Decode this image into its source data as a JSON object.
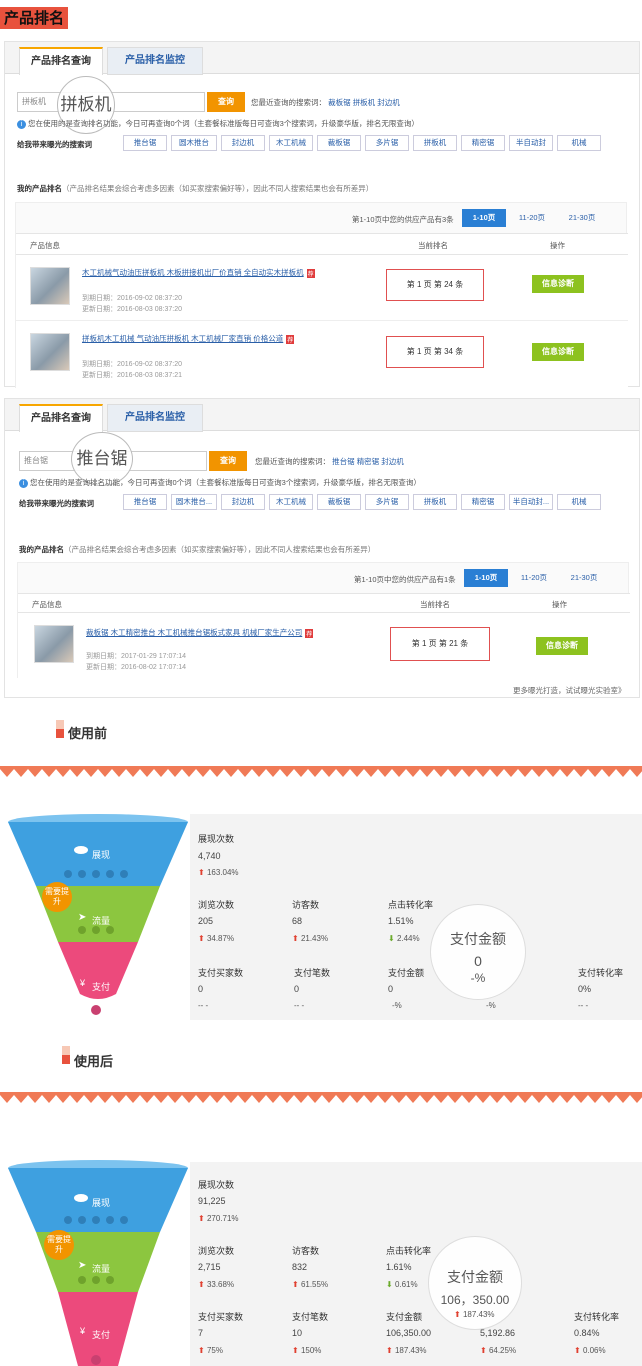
{
  "header_title": "产品排名",
  "panel1": {
    "tab_query": "产品排名查询",
    "tab_monitor": "产品排名监控",
    "search_placeholder": "拼板机",
    "query_btn": "查询",
    "circle_text": "拼板机",
    "recent_label": "您最近查询的搜索词：",
    "recent_keywords": [
      "裁板锯",
      "拼板机",
      "封边机"
    ],
    "notice": "您在使用的是查询排名功能，今日可再查询0个词（主套餐标准版每日可查询3个搜索词，升级豪华版，排名无限查询）",
    "rec_label": "给我带来曝光的搜索词",
    "rec_keywords": [
      "推台锯",
      "圆木推台",
      "封边机",
      "木工机械",
      "裁板锯",
      "多片锯",
      "拼板机",
      "精密锯",
      "半自动封",
      "机械"
    ],
    "my_rank_label": "我的产品排名",
    "my_rank_note": "（产品排名结果会综合考虑多因素（如买家搜索偏好等），因此不同人搜索结果也会有所差异）",
    "pager_summary": "第1-10页中您的供应产品有3条",
    "pages": [
      "1-10页",
      "11-20页",
      "21-30页"
    ],
    "col_product": "产品信息",
    "col_rank": "当前排名",
    "col_action": "操作",
    "rows": [
      {
        "title": "木工机械气动油压拼板机 木板拼接机出厂价直销 全自动实木拼板机",
        "exp": "到期日期：2016-09-02 08:37:20",
        "upd": "更新日期：2016-08-03 08:37:20",
        "rank": "第 1 页  第 24 条",
        "btn": "信息诊断"
      },
      {
        "title": "拼板机木工机械 气动油压拼板机 木工机械厂家直销 价格公道",
        "exp": "到期日期：2016-09-02 08:37:20",
        "upd": "更新日期：2016-08-03 08:37:21",
        "rank": "第 1 页  第 34 条",
        "btn": "信息诊断"
      }
    ]
  },
  "panel2": {
    "tab_query": "产品排名查询",
    "tab_monitor": "产品排名监控",
    "search_placeholder": "推台锯",
    "query_btn": "查询",
    "circle_text": "推台锯",
    "recent_label": "您最近查询的搜索词：",
    "recent_keywords": [
      "推台锯",
      "精密锯",
      "封边机"
    ],
    "notice": "您在使用的是查询排名功能，今日可再查询0个词（主套餐标准版每日可查询3个搜索词，升级豪华版，排名无限查询）",
    "rec_label": "给我带来曝光的搜索词",
    "rec_keywords": [
      "推台锯",
      "圆木推台...",
      "封边机",
      "木工机械",
      "裁板锯",
      "多片锯",
      "拼板机",
      "精密锯",
      "半自动封...",
      "机械"
    ],
    "my_rank_label": "我的产品排名",
    "my_rank_note": "（产品排名结果会综合考虑多因素（如买家搜索偏好等），因此不同人搜索结果也会有所差异）",
    "pager_summary": "第1-10页中您的供应产品有1条",
    "pages": [
      "1-10页",
      "11-20页",
      "21-30页"
    ],
    "col_product": "产品信息",
    "col_rank": "当前排名",
    "col_action": "操作",
    "rows": [
      {
        "title": "裁板锯 木工精密推台 木工机械推台锯板式家具 机械厂家生产公司",
        "exp": "到期日期：2017-01-29 17:07:14",
        "upd": "更新日期：2016-08-02 17:07:14",
        "rank": "第 1 页  第 21 条",
        "btn": "信息诊断"
      }
    ],
    "more_text": "更多曝光打造，试试曝光实验室》"
  },
  "before": {
    "label": "使用前",
    "funnel": {
      "show": "展现",
      "traffic": "流量",
      "pay": "支付",
      "badge": "需要提升"
    },
    "exposure": {
      "name": "展现次数",
      "value": "4,740",
      "pct": "163.04%"
    },
    "row2": [
      {
        "name": "浏览次数",
        "value": "205",
        "pct": "34.87%",
        "dir": "up"
      },
      {
        "name": "访客数",
        "value": "68",
        "pct": "21.43%",
        "dir": "up"
      },
      {
        "name": "点击转化率",
        "value": "1.51%",
        "pct": "2.44%",
        "dir": "down"
      }
    ],
    "row3": [
      {
        "name": "支付买家数",
        "value": "0",
        "pct": "-- -"
      },
      {
        "name": "支付笔数",
        "value": "0",
        "pct": "-- -"
      },
      {
        "name": "支付金额",
        "value": "0",
        "pct": "-%"
      },
      {
        "name": "",
        "value": "",
        "pct": "-%"
      },
      {
        "name": "支付转化率",
        "value": "0%",
        "pct": "-- -"
      }
    ],
    "circle": {
      "title": "支付金额",
      "value": "0",
      "pct": "-%"
    }
  },
  "after": {
    "label": "使用后",
    "funnel": {
      "show": "展现",
      "traffic": "流量",
      "pay": "支付",
      "badge": "需要提升"
    },
    "exposure": {
      "name": "展现次数",
      "value": "91,225",
      "pct": "270.71%"
    },
    "row2": [
      {
        "name": "浏览次数",
        "value": "2,715",
        "pct": "33.68%",
        "dir": "up"
      },
      {
        "name": "访客数",
        "value": "832",
        "pct": "61.55%",
        "dir": "up"
      },
      {
        "name": "点击转化率",
        "value": "1.61%",
        "pct": "0.61%",
        "dir": "down"
      }
    ],
    "row3": [
      {
        "name": "支付买家数",
        "value": "7",
        "pct": "75%"
      },
      {
        "name": "支付笔数",
        "value": "10",
        "pct": "150%"
      },
      {
        "name": "支付金额",
        "value": "106,350.00",
        "pct": "187.43%"
      },
      {
        "name": "",
        "value": "5,192.86",
        "pct": "64.25%"
      },
      {
        "name": "支付转化率",
        "value": "0.84%",
        "pct": "0.06%"
      }
    ],
    "circle": {
      "title": "支付金额",
      "value": "106，350.00",
      "pct": "187.43%"
    }
  },
  "colors": {
    "orange": "#f29400",
    "blue": "#2a7fd4",
    "green": "#8dc21f",
    "red": "#e05050",
    "funnel_top": "#3ea0e0",
    "funnel_mid": "#8cc63f",
    "funnel_bot": "#ec4a7c"
  }
}
